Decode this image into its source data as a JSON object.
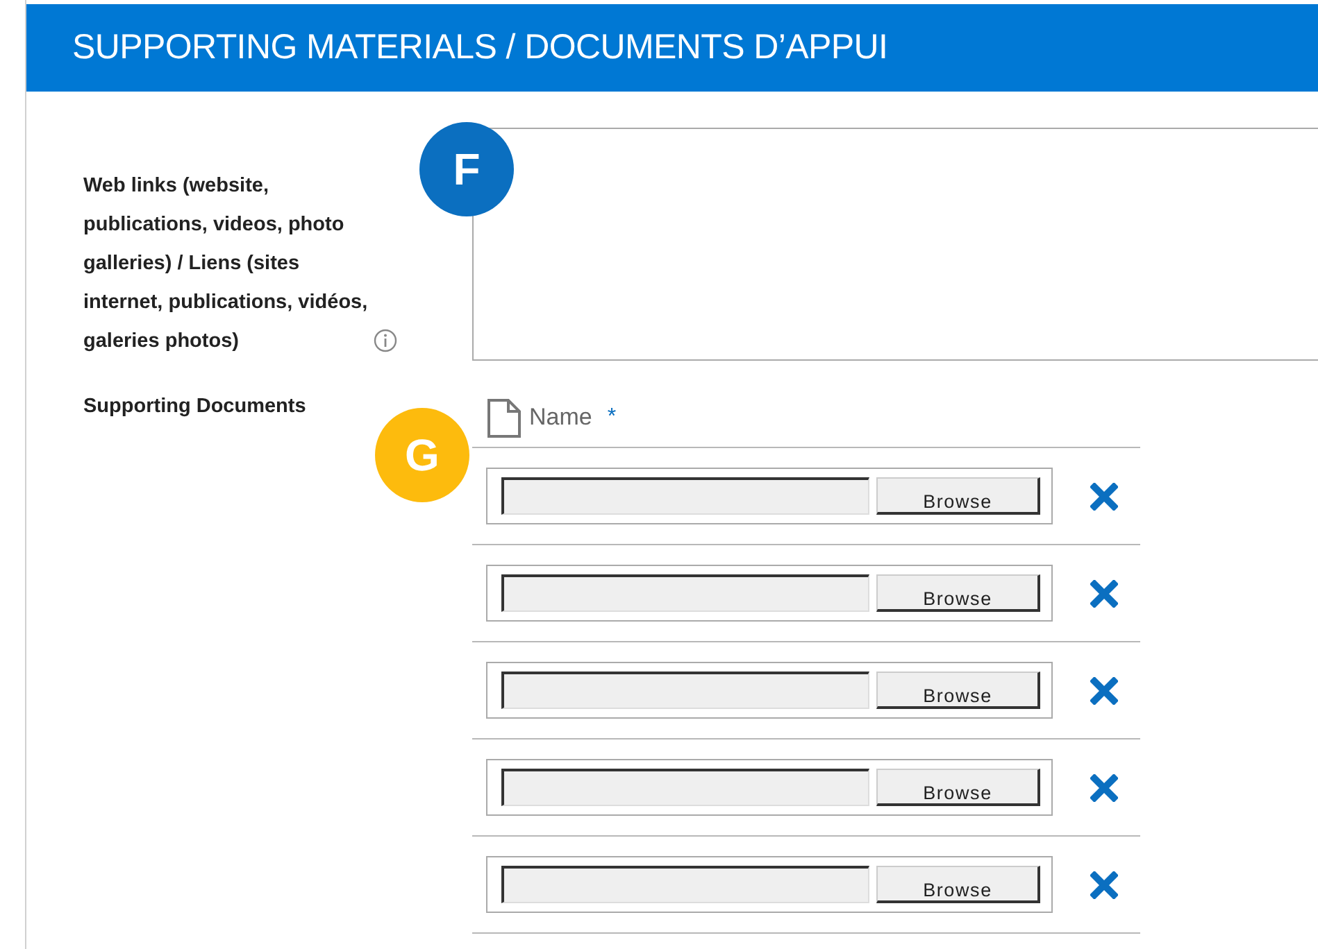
{
  "section": {
    "title": "SUPPORTING MATERIALS / DOCUMENTS D’APPUI"
  },
  "web_links": {
    "label": "Web links (website,\npublications, videos, photo\ngalleries) / Liens (sites\ninternet, publications, vidéos,\ngaleries photos)"
  },
  "supporting_documents": {
    "label": "Supporting Documents",
    "column": "Name",
    "required_mark": "*",
    "rows": [
      {
        "button": "Browse"
      },
      {
        "button": "Browse"
      },
      {
        "button": "Browse"
      },
      {
        "button": "Browse"
      },
      {
        "button": "Browse"
      }
    ]
  },
  "markers": [
    {
      "label": "F",
      "color": "#0b6fc0"
    },
    {
      "label": "G",
      "color": "#fdbb0d"
    }
  ]
}
